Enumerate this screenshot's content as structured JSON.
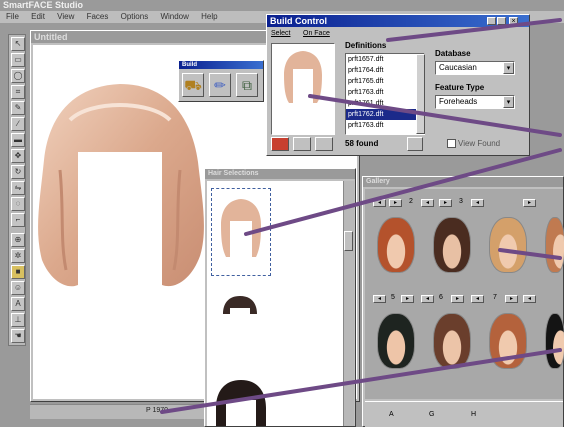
{
  "app": {
    "title": "SmartFACE Studio",
    "menu": [
      "File",
      "Edit",
      "View",
      "Faces",
      "Options",
      "Window",
      "Help"
    ]
  },
  "canvas_window": {
    "title": "Untitled"
  },
  "small_toolbar": {
    "title": "Build"
  },
  "build_control": {
    "title": "Build Control",
    "tabs": [
      "Select",
      "On Face"
    ],
    "definitions_label": "Definitions",
    "definitions": [
      "prft1657.dft",
      "prft1764.dft",
      "prft1765.dft",
      "prft1763.dft",
      "prft1761.dft",
      "prft1762.dft",
      "prft1763.dft"
    ],
    "selected_index": 5,
    "database_label": "Database",
    "database_value": "Caucasian",
    "feature_type_label": "Feature Type",
    "feature_type_value": "Foreheads",
    "found_text": "58 found",
    "view_found_label": "View Found"
  },
  "features_window": {
    "title": "Hair Selections"
  },
  "gallery_window": {
    "title": "Gallery",
    "row1_pages": [
      "2",
      "3"
    ],
    "row2_pages": [
      "5",
      "6",
      "7"
    ],
    "bottom_buttons": [
      "A",
      "G",
      "H"
    ]
  },
  "status": {
    "text": "P 1970"
  },
  "colors": {
    "accent": "#1b2a8a",
    "callout": "#6e4a86",
    "hair": "#e2b49a"
  }
}
